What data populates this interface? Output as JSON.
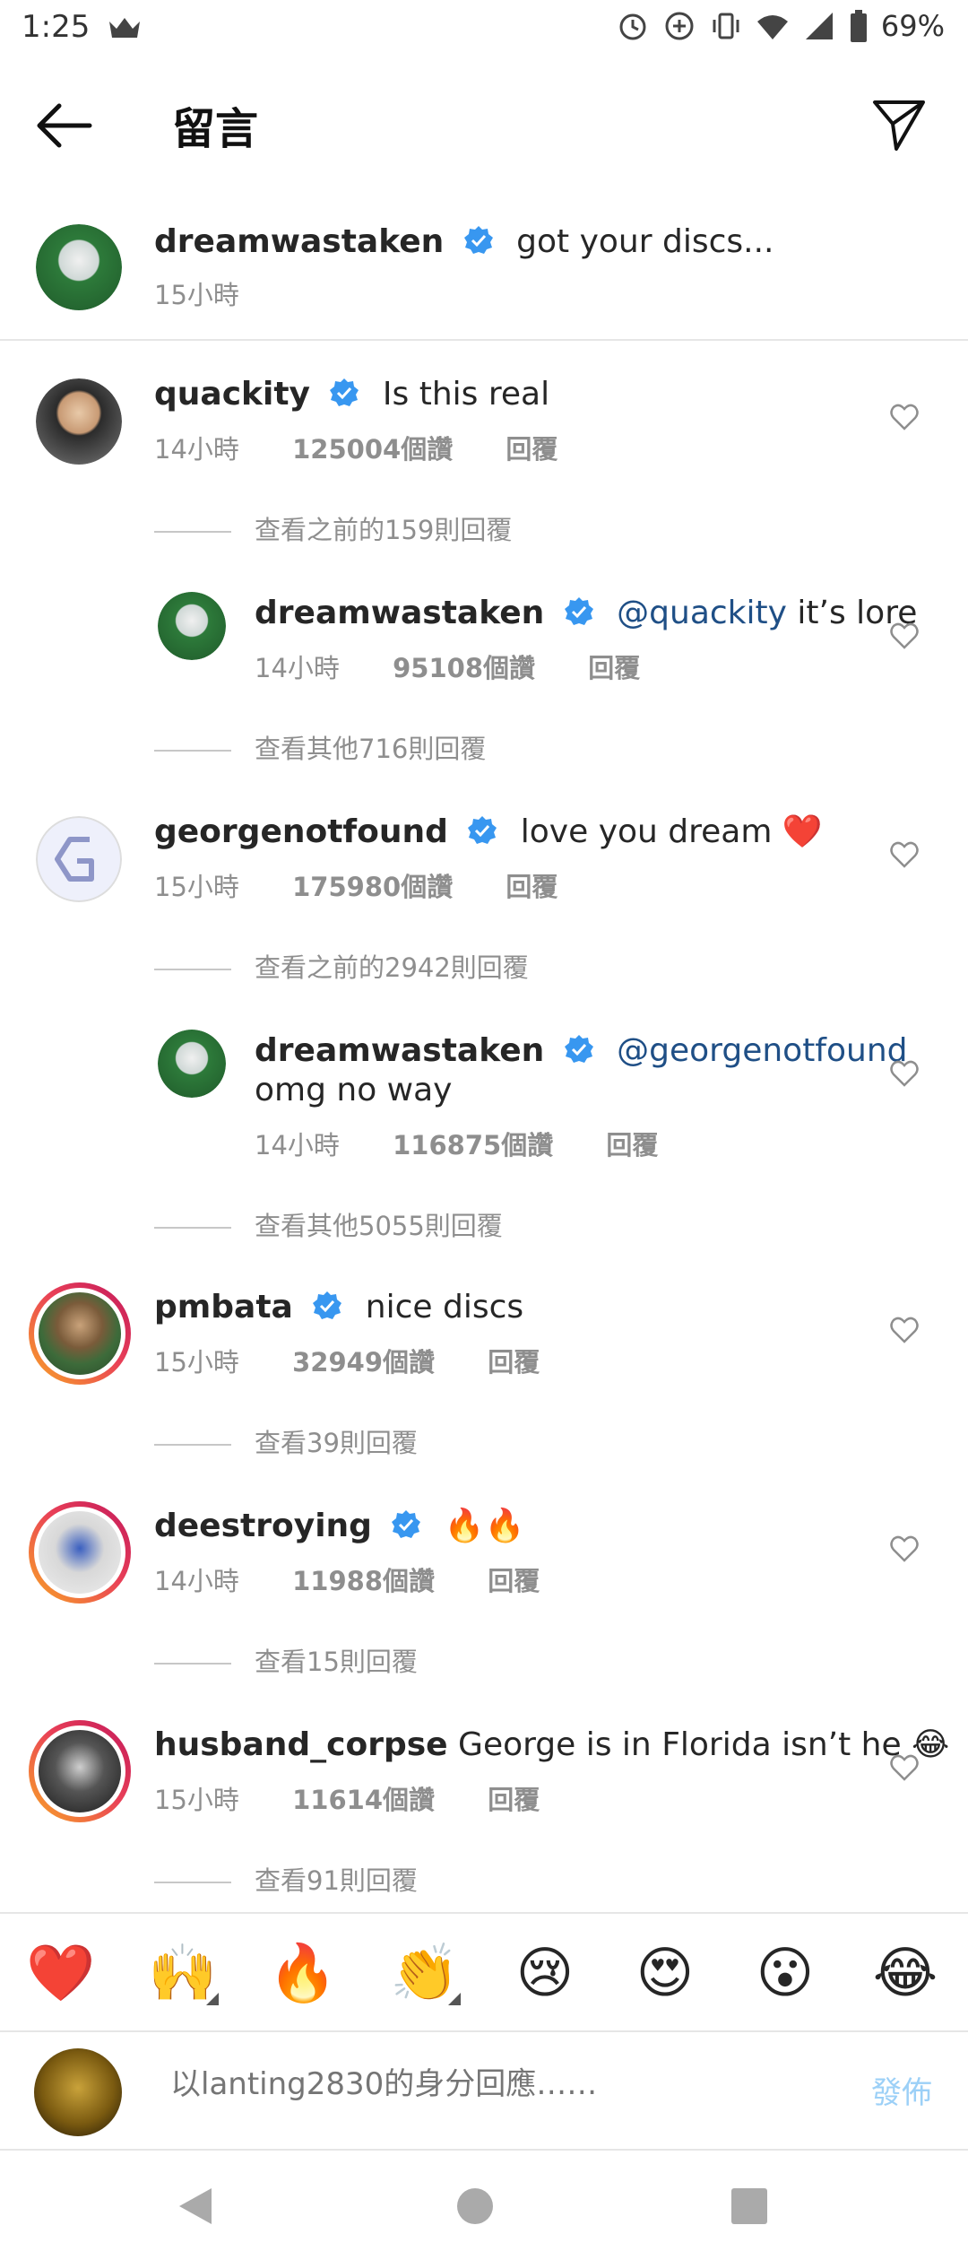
{
  "status": {
    "time": "1:25",
    "battery": "69%"
  },
  "header": {
    "title": "留言"
  },
  "caption": {
    "username": "dreamwastaken",
    "text": "got your discs...",
    "time": "15小時"
  },
  "comments": [
    {
      "username": "quackity",
      "text": "Is this real",
      "time": "14小時",
      "likes": "125004個讚",
      "reply": "回覆",
      "view_replies": "查看之前的159則回覆",
      "reply_item": {
        "username": "dreamwastaken",
        "mention": "@quackity",
        "text": "it’s lore",
        "time": "14小時",
        "likes": "95108個讚",
        "reply": "回覆",
        "view_more": "查看其他716則回覆"
      }
    },
    {
      "username": "georgenotfound",
      "text": "love you dream ❤️",
      "time": "15小時",
      "likes": "175980個讚",
      "reply": "回覆",
      "view_replies": "查看之前的2942則回覆",
      "reply_item": {
        "username": "dreamwastaken",
        "mention": "@georgenotfound",
        "text": "omg no way",
        "time": "14小時",
        "likes": "116875個讚",
        "reply": "回覆",
        "view_more": "查看其他5055則回覆"
      }
    },
    {
      "username": "pmbata",
      "text": "nice discs",
      "time": "15小時",
      "likes": "32949個讚",
      "reply": "回覆",
      "view_replies": "查看39則回覆"
    },
    {
      "username": "deestroying",
      "text": "🔥🔥",
      "time": "14小時",
      "likes": "11988個讚",
      "reply": "回覆",
      "view_replies": "查看15則回覆"
    },
    {
      "username": "husband_corpse",
      "text": "George is in Florida isn’t he 😂",
      "time": "15小時",
      "likes": "11614個讚",
      "reply": "回覆",
      "view_replies": "查看91則回覆"
    }
  ],
  "reactions": [
    "❤️",
    "🙌",
    "🔥",
    "👏",
    "😢",
    "😍",
    "😮",
    "😂"
  ],
  "composer": {
    "placeholder": "以lanting2830的身分回應……",
    "post": "發佈"
  },
  "colors": {
    "verified": "#3897f0",
    "mention": "#1f4f86",
    "muted": "#8e8e8e",
    "post_disabled": "#9cd0f7"
  }
}
